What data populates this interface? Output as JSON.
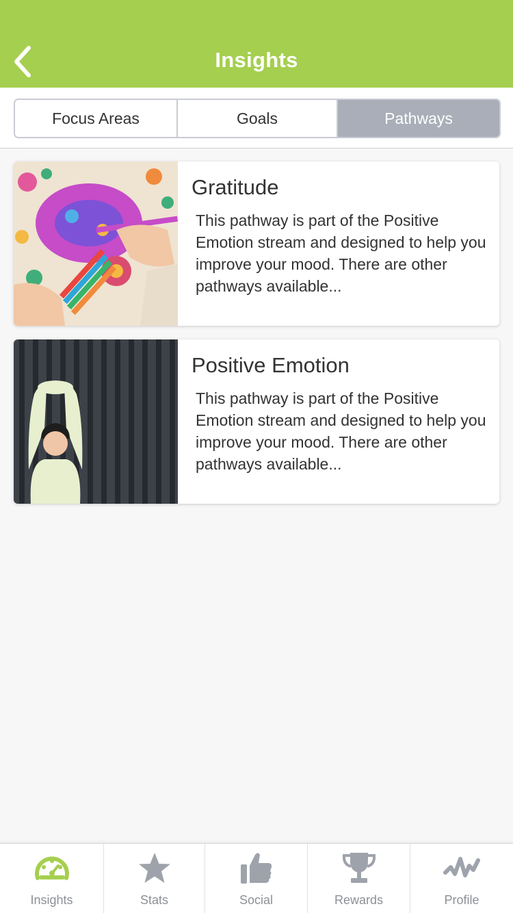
{
  "header": {
    "title": "Insights",
    "back_icon": "chevron-left-icon",
    "color": "#a5cf4f"
  },
  "segments": {
    "items": [
      "Focus Areas",
      "Goals",
      "Pathways"
    ],
    "selected": "Pathways"
  },
  "pathways": [
    {
      "title": "Gratitude",
      "description": "This pathway is part of the Positive Emotion stream and designed to help you improve your mood. There are other pathways available...",
      "image": "coloring-book-photo"
    },
    {
      "title": "Positive Emotion",
      "description": "This pathway is part of the Positive Emotion stream and designed to help you improve your mood. There are other pathways available...",
      "image": "woman-stretching-photo"
    }
  ],
  "tabbar": {
    "items": [
      {
        "label": "Insights",
        "icon": "gauge-icon",
        "active": true
      },
      {
        "label": "Stats",
        "icon": "star-icon",
        "active": false
      },
      {
        "label": "Social",
        "icon": "thumbs-up-icon",
        "active": false
      },
      {
        "label": "Rewards",
        "icon": "trophy-icon",
        "active": false
      },
      {
        "label": "Profile",
        "icon": "activity-icon",
        "active": false
      }
    ],
    "active_color": "#a5cf4f",
    "inactive_color": "#9ea3ab"
  }
}
